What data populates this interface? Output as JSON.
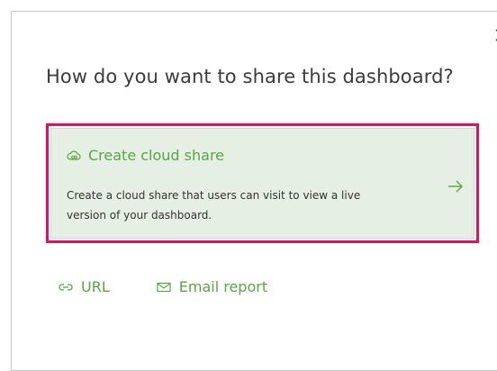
{
  "dialog": {
    "title": "How do you want to share this dashboard?",
    "close_icon": "close-icon"
  },
  "cloud_share": {
    "label": "Create cloud share",
    "description": "Create a cloud share that users can visit to view a live version of your dashboard.",
    "icon": "cloud-link-icon",
    "arrow_icon": "arrow-right-icon"
  },
  "options": [
    {
      "label": "URL",
      "icon": "link-icon"
    },
    {
      "label": "Email report",
      "icon": "envelope-icon"
    }
  ],
  "colors": {
    "accent_green": "#59a544",
    "card_background": "#e6efe3",
    "highlight_border": "#e0115f",
    "title_text": "#3b3b3b"
  }
}
